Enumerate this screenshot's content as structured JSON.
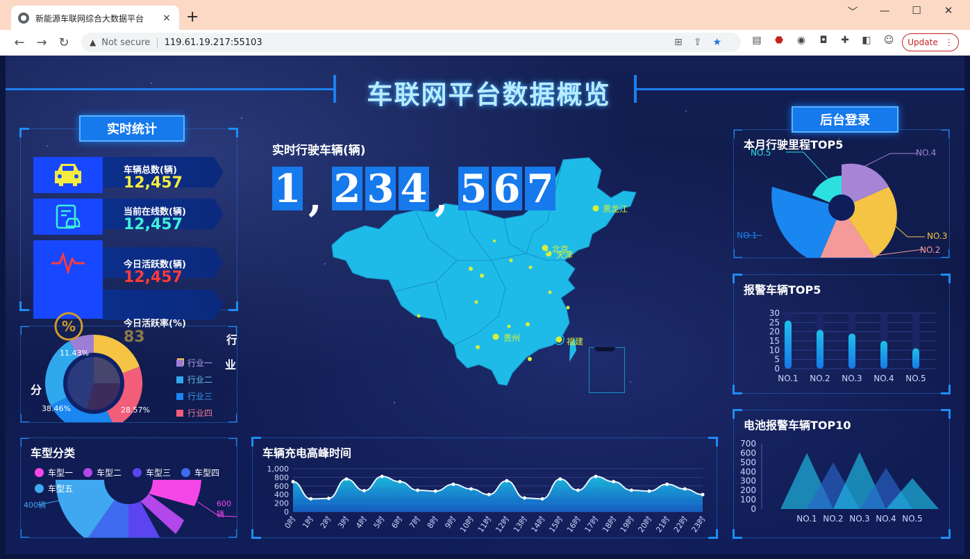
{
  "browser": {
    "tab_title": "新能源车联网综合大数据平台",
    "tab_close": "×",
    "new_tab": "+",
    "security_label": "Not secure",
    "url": "119.61.19.217:55103",
    "update_label": "Update",
    "window_controls": [
      "﹀",
      "—",
      "☐",
      "✕"
    ]
  },
  "page": {
    "title": "车联网平台数据概览",
    "realtime_badge": "实时统计",
    "login_badge": "后台登录",
    "running_label": "实时行驶车辆(辆)",
    "running_digits": [
      "1",
      ",",
      "2",
      "3",
      "4",
      ",",
      "5",
      "6",
      "7"
    ],
    "stats": [
      {
        "label": "车辆总数(辆)",
        "value": "12,457",
        "color": "#f5ec42",
        "icon": "car-icon"
      },
      {
        "label": "当前在线数(辆)",
        "value": "12,457",
        "color": "#3ff0d6",
        "icon": "clipboard-car-icon"
      },
      {
        "label": "今日活跃数(辆)",
        "value": "12,457",
        "color": "#ff3b3b",
        "icon": "pulse-icon"
      },
      {
        "label": "今日活跃率(%)",
        "value": "83",
        "color": "#f0b43a",
        "icon": "percent-icon"
      }
    ]
  },
  "industry": {
    "title_partial": "行",
    "side_label": "分",
    "label_partial": "业",
    "legend": [
      {
        "name": "行业一",
        "color": "#9c7ed6"
      },
      {
        "name": "行业二",
        "color": "#30a8ee"
      },
      {
        "name": "行业三",
        "color": "#1a86ef"
      },
      {
        "name": "行业四",
        "color": "#f25d7a"
      }
    ],
    "pct_a": "38.46%",
    "pct_b": "28.57%",
    "pct_top": "11.43%"
  },
  "vehicle_type": {
    "title": "车型分类",
    "legend": [
      {
        "name": "车型一",
        "color": "#f547e8"
      },
      {
        "name": "车型二",
        "color": "#b247ea"
      },
      {
        "name": "车型三",
        "color": "#5b45f0"
      },
      {
        "name": "车型四",
        "color": "#3f6bf0"
      },
      {
        "name": "车型五",
        "color": "#3fa8f0"
      }
    ],
    "left_value": "400辆",
    "right_value": "600辆"
  },
  "map": {
    "cities": [
      {
        "name": "黑龙江"
      },
      {
        "name": "北京"
      },
      {
        "name": "天津"
      },
      {
        "name": "贵州"
      },
      {
        "name": "福建"
      }
    ]
  },
  "mileage": {
    "title": "本月行驶里程TOP5",
    "labels": [
      "NO.1",
      "NO.2",
      "NO.3",
      "NO.4",
      "NO.5"
    ],
    "values": [
      100,
      80,
      70,
      55,
      40
    ],
    "colors": [
      "#1a86ef",
      "#f59a9a",
      "#f5c444",
      "#a684d6",
      "#2be0df"
    ]
  },
  "chart_data": [
    {
      "type": "bar",
      "title": "报警车辆TOP5",
      "categories": [
        "NO.1",
        "NO.2",
        "NO.3",
        "NO.4",
        "NO.5"
      ],
      "values": [
        26,
        21,
        19,
        15,
        11
      ],
      "ylim": [
        0,
        30
      ],
      "yticks": [
        0,
        5,
        10,
        15,
        20,
        25,
        30
      ]
    },
    {
      "type": "area",
      "title": "车辆充电高峰时间",
      "x": [
        "0时",
        "1时",
        "2时",
        "3时",
        "4时",
        "5时",
        "6时",
        "7时",
        "8时",
        "9时",
        "10时",
        "11时",
        "12时",
        "13时",
        "14时",
        "15时",
        "16时",
        "17时",
        "18时",
        "19时",
        "20时",
        "21时",
        "22时",
        "23时"
      ],
      "values": [
        700,
        300,
        310,
        760,
        490,
        820,
        700,
        500,
        480,
        640,
        530,
        400,
        720,
        320,
        300,
        760,
        500,
        820,
        700,
        500,
        480,
        640,
        530,
        400
      ],
      "ylim": [
        0,
        1000
      ],
      "yticks": [
        "0",
        "200",
        "400",
        "600",
        "800",
        "1,000"
      ]
    },
    {
      "type": "bar",
      "title": "电池报警车辆TOP10",
      "categories": [
        "NO.1",
        "NO.2",
        "NO.3",
        "NO.4",
        "NO.5"
      ],
      "values": [
        600,
        500,
        610,
        440,
        330
      ],
      "ylim": [
        0,
        700
      ],
      "yticks": [
        0,
        100,
        200,
        300,
        400,
        500,
        600,
        700
      ]
    }
  ]
}
